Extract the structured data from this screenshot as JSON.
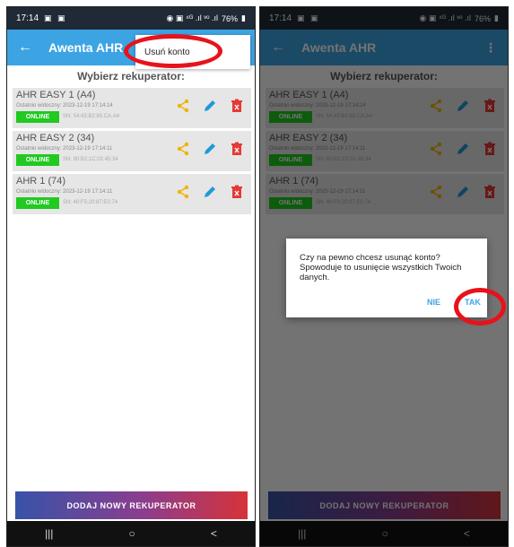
{
  "status": {
    "time": "17:14",
    "battery": "76%",
    "left_icons": "▣ ▣",
    "right_icons": "◉ ▣ ⁴ᴳ .ıl ᵛᵒ .ıl"
  },
  "appbar": {
    "title": "Awenta AHR"
  },
  "menu": {
    "delete_account": "Usuń konto"
  },
  "list_title": "Wybierz rekuperator:",
  "devices": [
    {
      "name": "AHR EASY 1 (A4)",
      "seen": "Ostatnio widoczny: 2023-12-19 17:14:14",
      "status": "ONLINE",
      "sn": "SN: 54:43:B2:85:CA:A4"
    },
    {
      "name": "AHR EASY 2 (34)",
      "seen": "Ostatnio widoczny: 2023-12-19 17:14:11",
      "status": "ONLINE",
      "sn": "SN: 80:B2:1C:01:45:34"
    },
    {
      "name": "AHR 1 (74)",
      "seen": "Ostatnio widoczny: 2023-12-19 17:14:11",
      "status": "ONLINE",
      "sn": "SN: 40:F5:20:87:E0:74"
    }
  ],
  "add_button": "DODAJ NOWY REKUPERATOR",
  "nav": {
    "recent": "|||",
    "home": "○",
    "back": "<"
  },
  "dialog": {
    "message": "Czy na pewno chcesz usunąć konto? Spowoduje to usunięcie wszystkich Twoich danych.",
    "no": "NIE",
    "yes": "TAK"
  },
  "colors": {
    "appbar": "#3da4e4",
    "online": "#21c921",
    "share": "#f0b400",
    "edit": "#1f9ad6",
    "delete": "#e53935",
    "highlight": "#e8121a"
  }
}
